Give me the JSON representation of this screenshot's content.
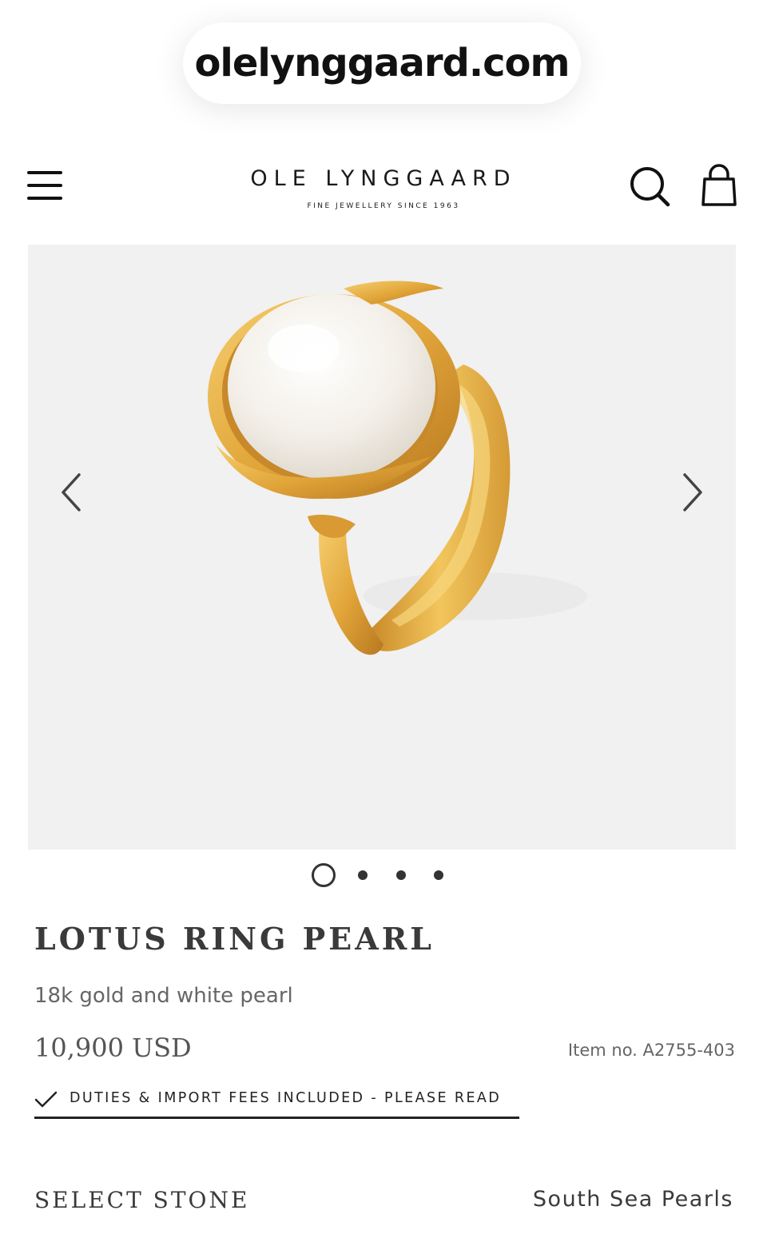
{
  "browser": {
    "url": "olelynggaard.com"
  },
  "header": {
    "brand": "OLE LYNGGAARD",
    "tagline": "FINE JEWELLERY SINCE 1963",
    "icons": [
      "menu-icon",
      "search-icon",
      "shopping-bag-icon"
    ]
  },
  "gallery": {
    "image_subject": "gold-ring-with-white-pearl",
    "slide_count": 4,
    "active_slide": 1,
    "icons": [
      "chevron-left-icon",
      "chevron-right-icon"
    ]
  },
  "product": {
    "title": "LOTUS RING PEARL",
    "subtitle": "18k gold and white pearl",
    "price": "10,900 USD",
    "item_no": "Item no. A2755-403",
    "duties_label": "DUTIES & IMPORT FEES INCLUDED - PLEASE READ"
  },
  "stone": {
    "label": "SELECT STONE",
    "value": "South Sea Pearls"
  },
  "colors": {
    "gallery_bg": "#f1f1f1",
    "gold": "#e2a63a",
    "pearl": "#f7f3ec",
    "text": "#3a3a3a"
  }
}
